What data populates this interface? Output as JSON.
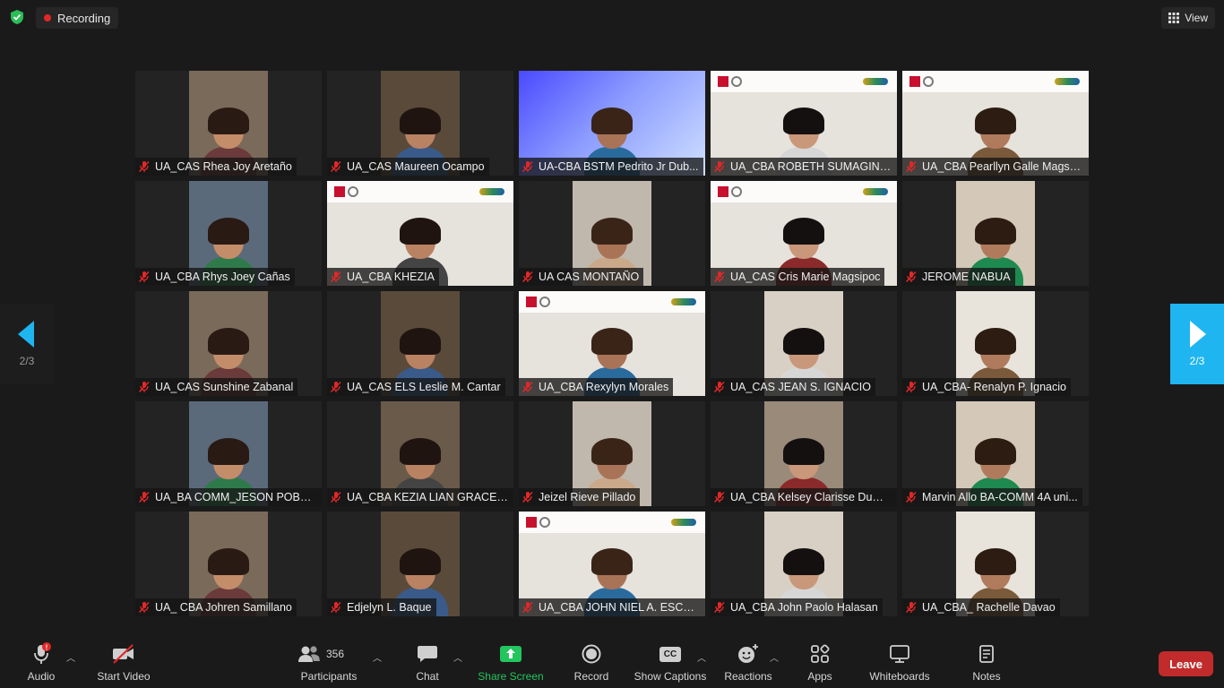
{
  "topbar": {
    "recording_label": "Recording",
    "view_label": "View"
  },
  "colors": {
    "accent_blue": "#1fb5f0",
    "recording_red": "#e02828",
    "leave_red": "#c22b2b",
    "share_green": "#22c55e",
    "shield_green": "#2bbd57"
  },
  "participants": [
    {
      "name": "UA_CAS Rhea Joy Aretaño"
    },
    {
      "name": "UA_CAS Maureen Ocampo"
    },
    {
      "name": "UA-CBA BSTM Pedrito Jr Dub..."
    },
    {
      "name": "UA_CBA ROBETH SUMAGING..."
    },
    {
      "name": "UA_CBA Pearllyn Galle Magsp..."
    },
    {
      "name": "UA_CBA Rhys Joey Cañas"
    },
    {
      "name": "UA_CBA KHEZIA"
    },
    {
      "name": "UA CAS MONTAÑO"
    },
    {
      "name": "UA_CAS Cris Marie Magsipoc"
    },
    {
      "name": "JEROME NABUA"
    },
    {
      "name": "UA_CAS Sunshine Zabanal"
    },
    {
      "name": "UA_CAS ELS Leslie M. Cantar"
    },
    {
      "name": "UA_CBA Rexylyn Morales"
    },
    {
      "name": "UA_CAS JEAN S. IGNACIO"
    },
    {
      "name": "UA_CBA- Renalyn P. Ignacio"
    },
    {
      "name": "UA_BA COMM_JESON POBLA..."
    },
    {
      "name": "UA_CBA KEZIA LIAN GRACE E...."
    },
    {
      "name": "Jeizel Rieve Pillado"
    },
    {
      "name": "UA_CBA Kelsey Clarisse Dumd..."
    },
    {
      "name": "Marvin Allo BA-COMM 4A uni..."
    },
    {
      "name": "UA_ CBA Johren Samillano"
    },
    {
      "name": "Edjelyn L. Baque"
    },
    {
      "name": "UA_CBA JOHN NIEL A. ESCOT..."
    },
    {
      "name": "UA_CBA John Paolo Halasan"
    },
    {
      "name": "UA_CBA_ Rachelle Davao"
    }
  ],
  "pager": {
    "left_label": "2/3",
    "right_label": "2/3"
  },
  "toolbar": {
    "audio": "Audio",
    "start_video": "Start Video",
    "participants": "Participants",
    "participants_count": "356",
    "chat": "Chat",
    "share_screen": "Share Screen",
    "record": "Record",
    "show_captions": "Show Captions",
    "captions_badge": "CC",
    "reactions": "Reactions",
    "apps": "Apps",
    "whiteboards": "Whiteboards",
    "notes": "Notes",
    "leave": "Leave"
  }
}
